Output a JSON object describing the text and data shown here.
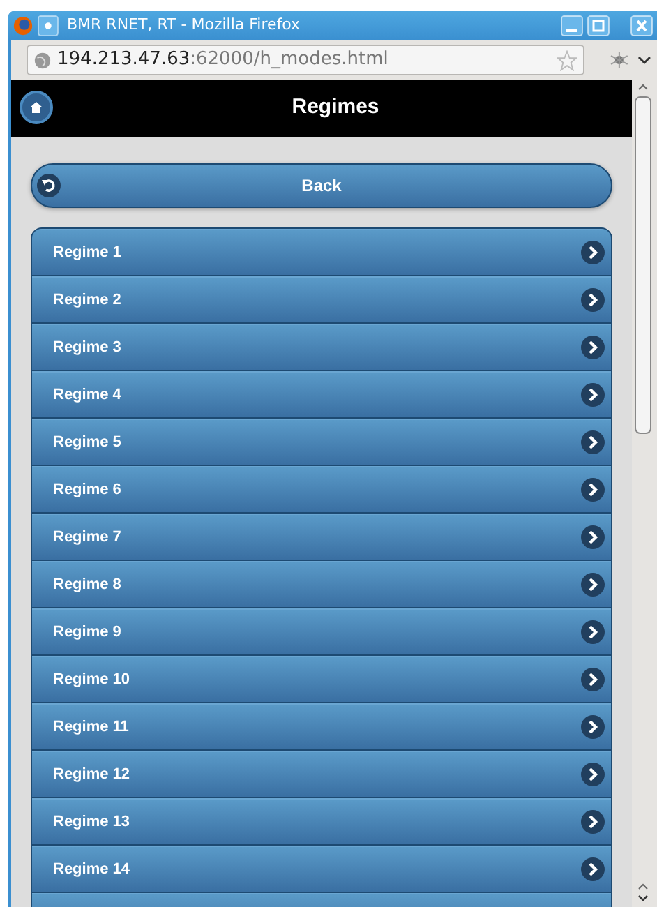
{
  "window": {
    "title": "BMR RNET, RT - Mozilla Firefox"
  },
  "address_bar": {
    "host": "194.213.47.63",
    "path": ":62000/h_modes.html"
  },
  "header": {
    "title": "Regimes"
  },
  "back_button": {
    "label": "Back"
  },
  "list": {
    "items": [
      {
        "label": "Regime 1"
      },
      {
        "label": "Regime 2"
      },
      {
        "label": "Regime 3"
      },
      {
        "label": "Regime 4"
      },
      {
        "label": "Regime 5"
      },
      {
        "label": "Regime 6"
      },
      {
        "label": "Regime 7"
      },
      {
        "label": "Regime 8"
      },
      {
        "label": "Regime 9"
      },
      {
        "label": "Regime 10"
      },
      {
        "label": "Regime 11"
      },
      {
        "label": "Regime 12"
      },
      {
        "label": "Regime 13"
      },
      {
        "label": "Regime 14"
      }
    ]
  }
}
